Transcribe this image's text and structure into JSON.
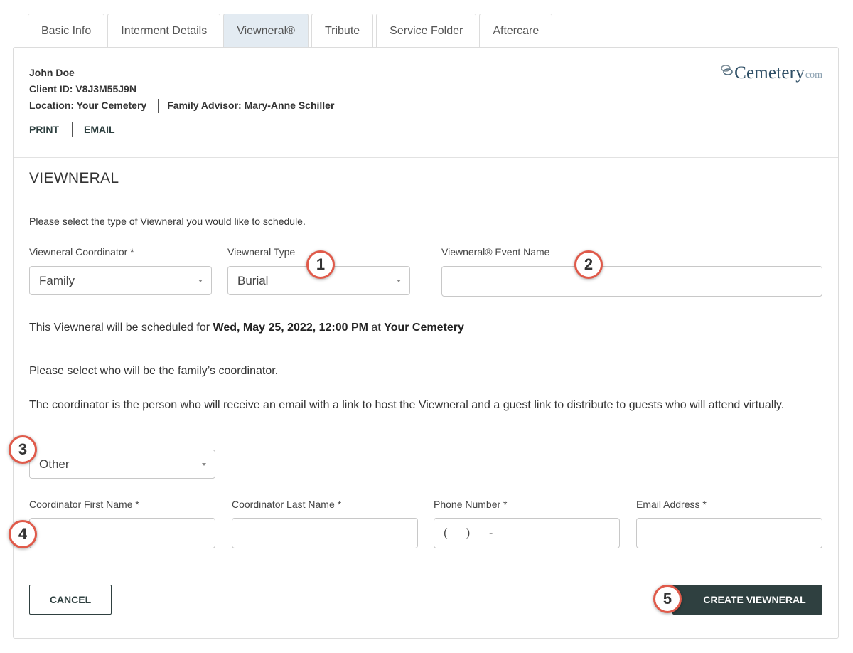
{
  "tabs": [
    "Basic Info",
    "Interment Details",
    "Viewneral®",
    "Tribute",
    "Service Folder",
    "Aftercare"
  ],
  "client": {
    "name": "John Doe",
    "client_id": "Client ID: V8J3M55J9N",
    "location": "Location: Your Cemetery",
    "advisor": "Family Advisor: Mary-Anne Schiller"
  },
  "links": {
    "print": "PRINT",
    "email": "EMAIL"
  },
  "logo": {
    "word": "Cemetery",
    "suffix": "com"
  },
  "section_title": "VIEWNERAL",
  "intro": "Please select the type of Viewneral you would like to schedule.",
  "fields": {
    "coordinator_label": "Viewneral Coordinator *",
    "coordinator_value": "Family",
    "type_label": "Viewneral Type",
    "type_value": "Burial",
    "event_name_label": "Viewneral® Event Name",
    "event_name_value": ""
  },
  "schedule": {
    "prefix": "This Viewneral will be scheduled for ",
    "datetime": "Wed, May 25, 2022, 12:00 PM",
    "middle": " at ",
    "place": "Your Cemetery"
  },
  "select_coordinator_text": "Please select who will be the family’s coordinator.",
  "coordinator_desc": "The coordinator is the person who will receive an email with a link to host the Viewneral and a guest link to distribute to guests who will attend virtually.",
  "coordinator_select_value": "Other",
  "contact": {
    "first_name_label": "Coordinator First Name *",
    "last_name_label": "Coordinator Last Name *",
    "phone_label": "Phone Number *",
    "phone_placeholder": "(___)___-____",
    "email_label": "Email Address *"
  },
  "buttons": {
    "cancel": "CANCEL",
    "create": "CREATE VIEWNERAL"
  },
  "badges": [
    "1",
    "2",
    "3",
    "4",
    "5"
  ],
  "colors": {
    "active_tab": "#e3ebf2",
    "primary_button": "#2f4040",
    "badge_ring": "#e05a4a"
  }
}
